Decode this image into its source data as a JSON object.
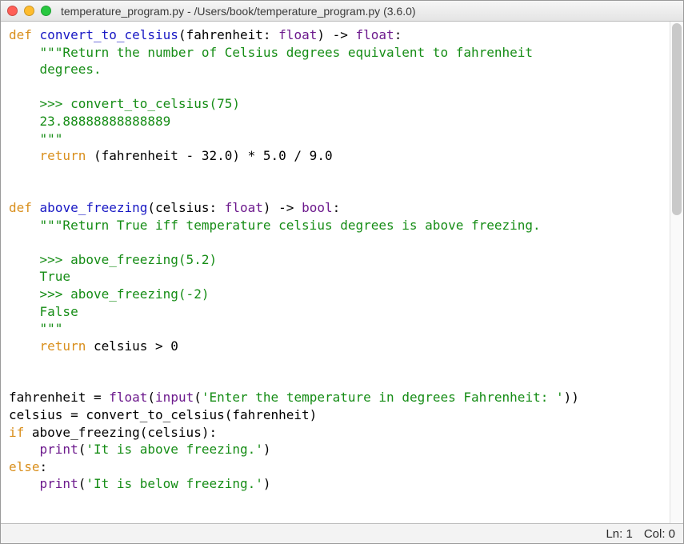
{
  "window": {
    "title": "temperature_program.py - /Users/book/temperature_program.py (3.6.0)"
  },
  "statusbar": {
    "line_label": "Ln: 1",
    "col_label": "Col: 0"
  },
  "code": {
    "f1": {
      "kw_def": "def",
      "name": "convert_to_celsius",
      "params_open": "(fahrenheit: ",
      "type1": "float",
      "params_mid": ") -> ",
      "type2": "float",
      "colon": ":",
      "doc1": "    \"\"\"Return the number of Celsius degrees equivalent to fahrenheit",
      "doc2": "    degrees.",
      "doc_blank": "",
      "doc3": "    >>> convert_to_celsius(75)",
      "doc4": "    23.88888888888889",
      "doc5": "    \"\"\"",
      "ret_kw": "    return",
      "ret_expr": " (fahrenheit - 32.0) * 5.0 / 9.0"
    },
    "f2": {
      "kw_def": "def",
      "name": "above_freezing",
      "params_open": "(celsius: ",
      "type1": "float",
      "params_mid": ") -> ",
      "type2": "bool",
      "colon": ":",
      "doc1": "    \"\"\"Return True iff temperature celsius degrees is above freezing.",
      "doc_blank": "",
      "doc2": "    >>> above_freezing(5.2)",
      "doc3": "    True",
      "doc4": "    >>> above_freezing(-2)",
      "doc5": "    False",
      "doc6": "    \"\"\"",
      "ret_kw": "    return",
      "ret_expr": " celsius > 0"
    },
    "main": {
      "l1a": "fahrenheit = ",
      "l1_float": "float",
      "l1b": "(",
      "l1_input": "input",
      "l1c": "(",
      "l1_str": "'Enter the temperature in degrees Fahrenheit: '",
      "l1d": "))",
      "l2": "celsius = convert_to_celsius(fahrenheit)",
      "l3_if": "if",
      "l3_rest": " above_freezing(celsius):",
      "l4a": "    ",
      "l4_print": "print",
      "l4b": "(",
      "l4_str": "'It is above freezing.'",
      "l4c": ")",
      "l5_else": "else",
      "l5_colon": ":",
      "l6a": "    ",
      "l6_print": "print",
      "l6b": "(",
      "l6_str": "'It is below freezing.'",
      "l6c": ")"
    }
  }
}
